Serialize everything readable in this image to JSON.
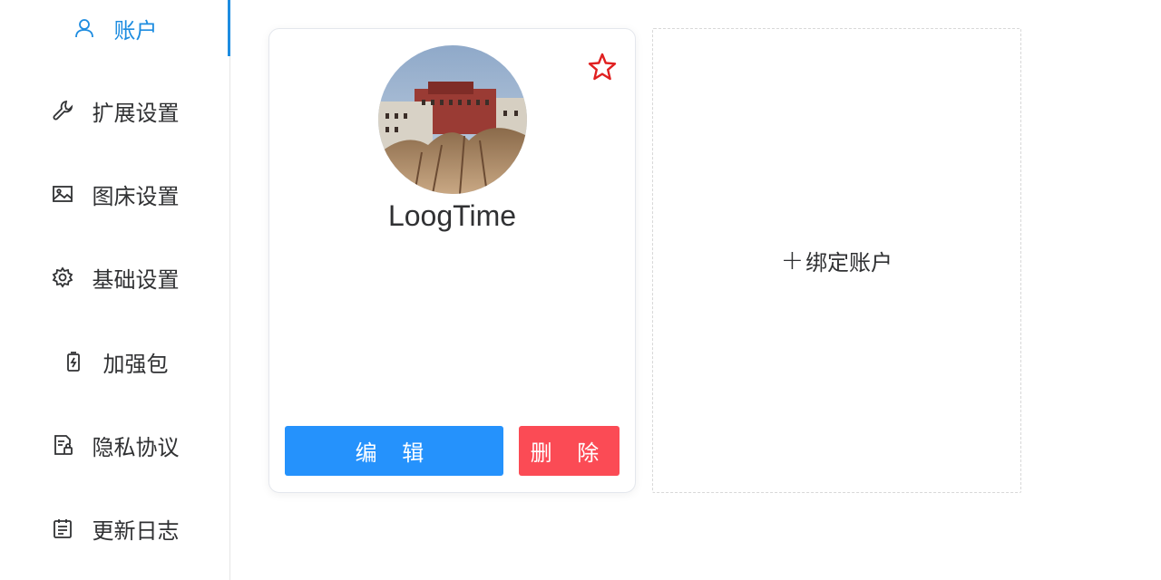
{
  "sidebar": {
    "items": [
      {
        "label": "账户",
        "icon": "user-icon",
        "active": true
      },
      {
        "label": "扩展设置",
        "icon": "wrench-icon"
      },
      {
        "label": "图床设置",
        "icon": "image-icon"
      },
      {
        "label": "基础设置",
        "icon": "gear-icon"
      },
      {
        "label": "加强包",
        "icon": "battery-charge-icon"
      },
      {
        "label": "隐私协议",
        "icon": "document-lock-icon"
      },
      {
        "label": "更新日志",
        "icon": "calendar-log-icon"
      }
    ]
  },
  "account_card": {
    "username": "LoogTime",
    "avatar": "landscape-photo",
    "favorite_icon": "star-icon",
    "edit_label": "编 辑",
    "delete_label": "删 除"
  },
  "add_account": {
    "plus": "+",
    "label": "绑定账户"
  },
  "colors": {
    "accent": "#1d8ce0",
    "edit_button": "#2592fc",
    "delete_button": "#fb4b55",
    "star": "#e02020"
  }
}
